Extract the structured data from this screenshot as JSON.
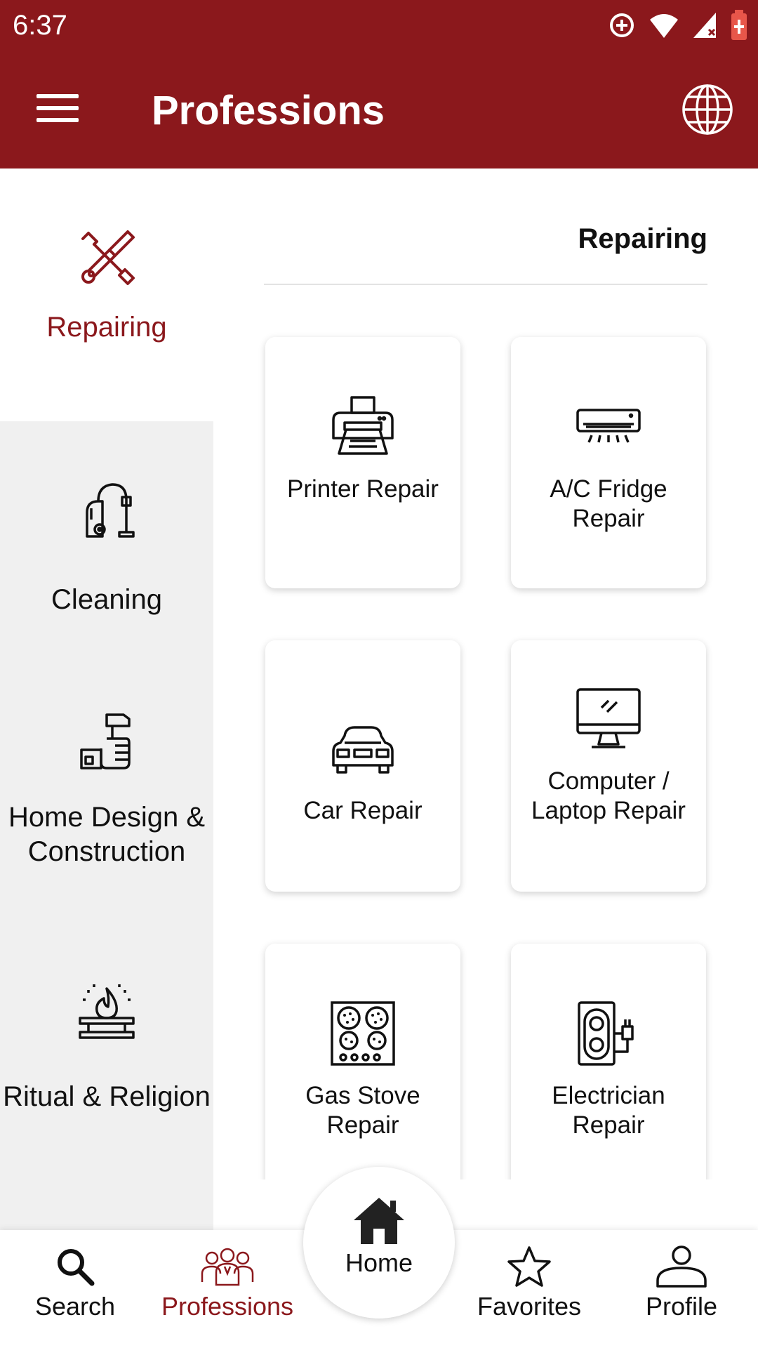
{
  "status": {
    "time": "6:37"
  },
  "appbar": {
    "title": "Professions"
  },
  "sidebar": {
    "items": [
      {
        "label": "Repairing",
        "icon": "repair-tools-icon",
        "active": true
      },
      {
        "label": "Cleaning",
        "icon": "vacuum-cleaner-icon",
        "active": false
      },
      {
        "label": "Home Design & Construction",
        "icon": "hammer-hand-icon",
        "active": false
      },
      {
        "label": "Ritual & Religion",
        "icon": "fire-ritual-icon",
        "active": false
      }
    ]
  },
  "main": {
    "section_title": "Repairing",
    "cards": [
      {
        "label": "Printer Repair",
        "icon": "printer-icon"
      },
      {
        "label": "A/C Fridge Repair",
        "icon": "air-conditioner-icon"
      },
      {
        "label": "Car Repair",
        "icon": "car-icon"
      },
      {
        "label": "Computer / Laptop Repair",
        "icon": "computer-monitor-icon"
      },
      {
        "label": "Gas Stove Repair",
        "icon": "gas-stove-icon"
      },
      {
        "label": "Electrician Repair",
        "icon": "electric-socket-icon"
      }
    ]
  },
  "bottomnav": {
    "search": "Search",
    "professions": "Professions",
    "home": "Home",
    "favorites": "Favorites",
    "profile": "Profile"
  },
  "colors": {
    "brand": "#8b181c",
    "sidebar_bg": "#f0f0f0"
  }
}
